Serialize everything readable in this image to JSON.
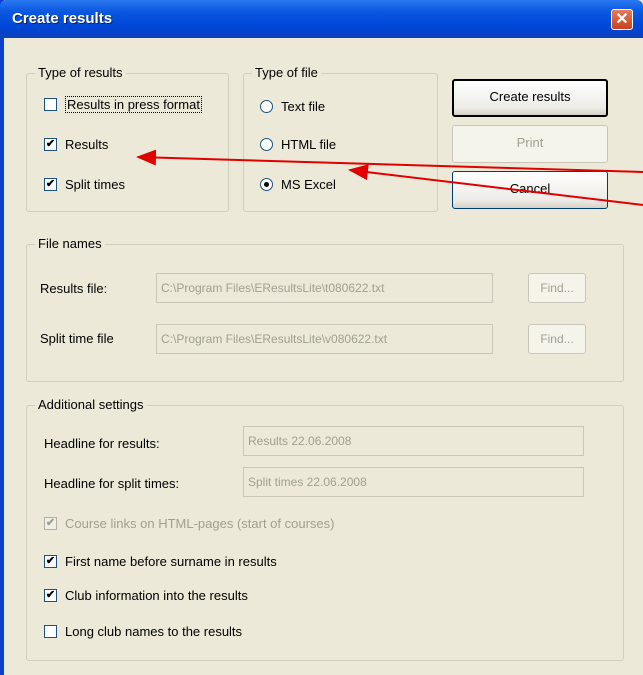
{
  "window": {
    "title": "Create results",
    "close_glyph": "✕"
  },
  "type_of_results": {
    "legend": "Type of results",
    "items": [
      {
        "label": "Results in press format",
        "checked": false
      },
      {
        "label": "Results",
        "checked": true
      },
      {
        "label": "Split times",
        "checked": true
      }
    ]
  },
  "type_of_file": {
    "legend": "Type of file",
    "options": [
      {
        "label": "Text file",
        "selected": false
      },
      {
        "label": "HTML file",
        "selected": false
      },
      {
        "label": "MS Excel",
        "selected": true
      }
    ]
  },
  "buttons": {
    "create": "Create results",
    "print": "Print",
    "cancel": "Cancel"
  },
  "file_names": {
    "legend": "File names",
    "results_label": "Results file:",
    "results_value": "C:\\Program Files\\EResultsLite\\t080622.txt",
    "split_label": "Split time file",
    "split_value": "C:\\Program Files\\EResultsLite\\v080622.txt",
    "find_label": "Find..."
  },
  "additional": {
    "legend": "Additional settings",
    "headline_results_label": "Headline for results:",
    "headline_results_value": "Results 22.06.2008",
    "headline_split_label": "Headline for split times:",
    "headline_split_value": "Split times 22.06.2008",
    "options": [
      {
        "label": "Course links on HTML-pages (start of courses)",
        "checked": true,
        "disabled": true
      },
      {
        "label": "First name before surname in results",
        "checked": true,
        "disabled": false
      },
      {
        "label": "Club information into the results",
        "checked": true,
        "disabled": false
      },
      {
        "label": "Long club names to the results",
        "checked": false,
        "disabled": false
      }
    ]
  },
  "colors": {
    "titlebar": "#0046d8",
    "annotation_arrow": "#e00000",
    "dialog_bg": "#ece9d8"
  }
}
